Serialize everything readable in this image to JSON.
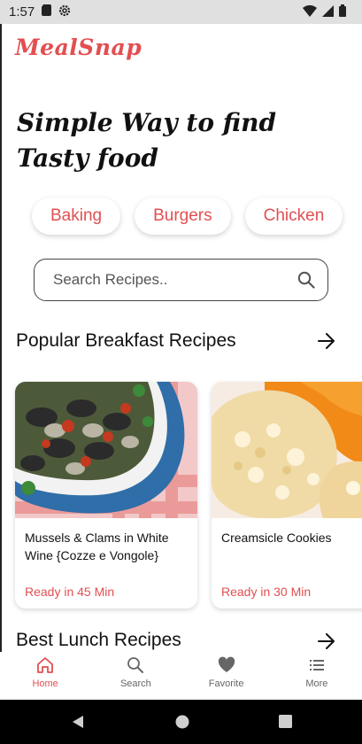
{
  "status_bar": {
    "time": "1:57",
    "left_icons": [
      "sd-card-icon",
      "settings-icon"
    ],
    "right_icons": [
      "wifi-icon",
      "signal-icon",
      "battery-icon"
    ]
  },
  "app": {
    "brand": "MealSnap",
    "headline_line1": "Simple Way to find",
    "headline_line2": "Tasty food",
    "chips": [
      "Baking",
      "Burgers",
      "Chicken"
    ],
    "search": {
      "placeholder": "Search Recipes.."
    },
    "popular": {
      "title": "Popular Breakfast Recipes",
      "recipes": [
        {
          "name": "Mussels & Clams in White Wine {Cozze e Vongole}",
          "ready": "Ready in 45 Min"
        },
        {
          "name": "Creamsicle Cookies",
          "ready": "Ready in 30 Min"
        }
      ]
    },
    "lunch": {
      "title": "Best Lunch Recipes"
    }
  },
  "bottom_nav": {
    "items": [
      {
        "label": "Home",
        "icon": "home-icon",
        "active": true
      },
      {
        "label": "Search",
        "icon": "search-icon",
        "active": false
      },
      {
        "label": "Favorite",
        "icon": "heart-icon",
        "active": false
      },
      {
        "label": "More",
        "icon": "menu-icon",
        "active": false
      }
    ]
  },
  "colors": {
    "accent": "#e24f51",
    "text": "#111111",
    "status_bar": "#e0e0e0"
  }
}
